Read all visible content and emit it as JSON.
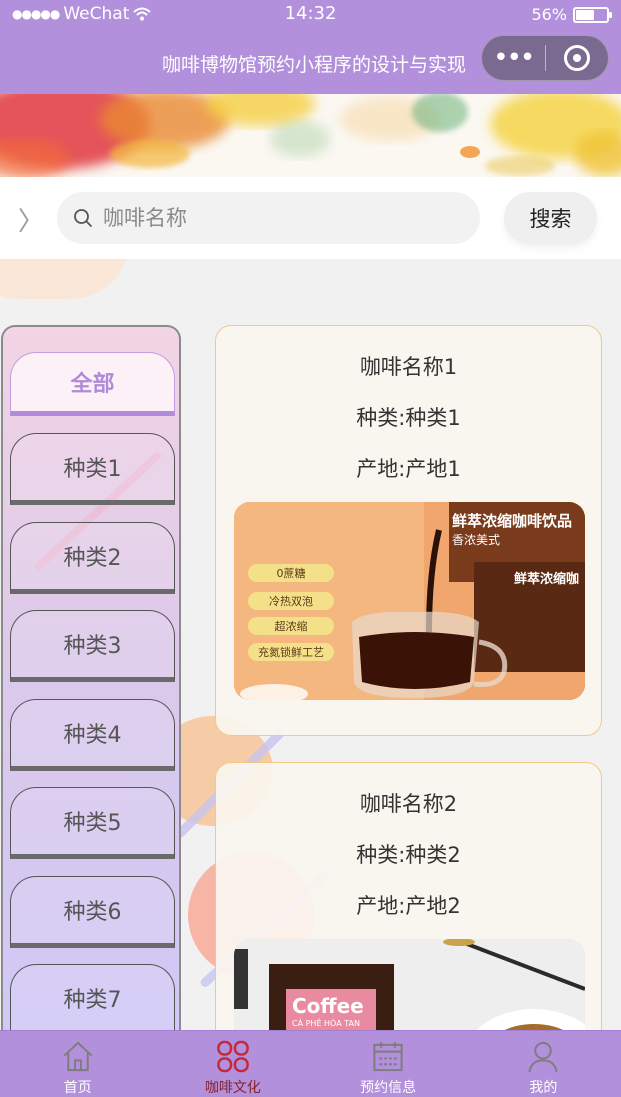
{
  "status_bar": {
    "carrier": "WeChat",
    "time": "14:32",
    "battery": "56%",
    "battery_level": 0.56
  },
  "nav": {
    "title": "咖啡博物馆预约小程序的设计与实现",
    "more_icon": "more-dots-icon",
    "close_icon": "target-circle-icon"
  },
  "search": {
    "placeholder": "咖啡名称",
    "value": "",
    "button_label": "搜索"
  },
  "categories": [
    {
      "label": "全部",
      "active": true
    },
    {
      "label": "种类1",
      "active": false
    },
    {
      "label": "种类2",
      "active": false
    },
    {
      "label": "种类3",
      "active": false
    },
    {
      "label": "种类4",
      "active": false
    },
    {
      "label": "种类5",
      "active": false
    },
    {
      "label": "种类6",
      "active": false
    },
    {
      "label": "种类7",
      "active": false
    }
  ],
  "cards": [
    {
      "name": "咖啡名称1",
      "category": "种类:种类1",
      "origin": "产地:产地1",
      "image": {
        "headline": "鲜萃浓缩咖啡饮品",
        "subhead": "香浓美式",
        "box_title": "鲜萃浓缩咖",
        "tags": [
          "0蔗糖",
          "冷热双泡",
          "超浓缩",
          "充氮锁鲜工艺"
        ]
      }
    },
    {
      "name": "咖啡名称2",
      "category": "种类:种类2",
      "origin": "产地:产地2",
      "image": {
        "brand": "Coffee",
        "tagline": "CÀ PHÊ HÒA TAN"
      }
    }
  ],
  "tabbar": [
    {
      "label": "首页",
      "icon": "home-icon",
      "active": false
    },
    {
      "label": "咖啡文化",
      "icon": "clover-icon",
      "active": true
    },
    {
      "label": "预约信息",
      "icon": "calendar-icon",
      "active": false
    },
    {
      "label": "我的",
      "icon": "user-icon",
      "active": false
    }
  ],
  "colors": {
    "theme": "#b390dc",
    "active_tab": "#8a1f2d",
    "card_border": "#f0c98a",
    "category_active_text": "#b08ad8"
  }
}
